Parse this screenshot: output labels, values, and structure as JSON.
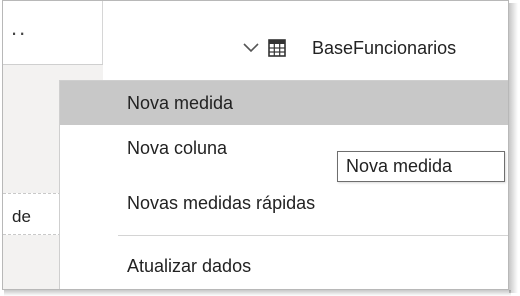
{
  "left_pane": {
    "overflow_indicator": "..",
    "cell_text": "de"
  },
  "field_list": {
    "table_name": "BaseFuncionarios",
    "expand_icon": "chevron-down-icon",
    "table_icon": "table-icon"
  },
  "context_menu": {
    "items": [
      {
        "label": "Nova medida",
        "state": "hover"
      },
      {
        "label": "Nova coluna"
      },
      {
        "label": "Novas medidas rápidas"
      },
      {
        "label": "Atualizar dados"
      }
    ]
  },
  "tooltip": {
    "text": "Nova medida"
  },
  "colors": {
    "hover_background": "#c8c8c8",
    "tooltip_border": "#6e6e6e",
    "text": "#222222"
  }
}
